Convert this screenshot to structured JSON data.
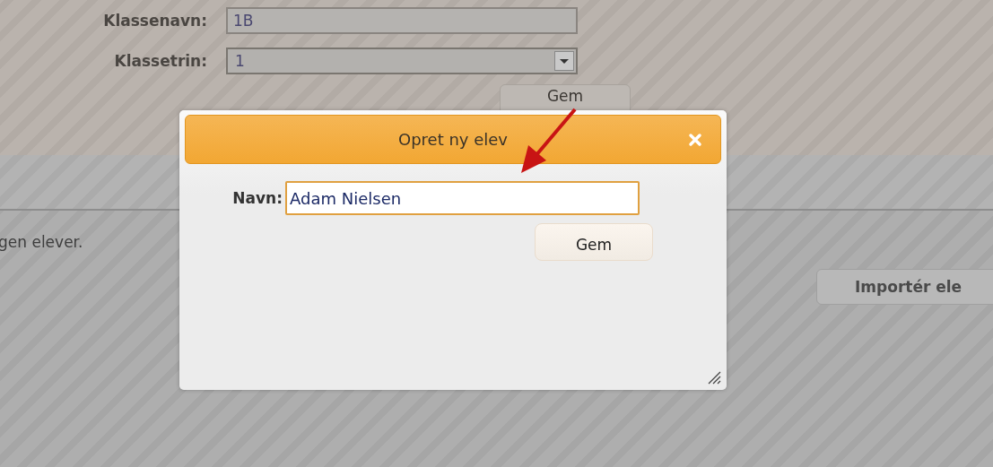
{
  "page": {
    "fields": [
      {
        "label": "Klassenavn:",
        "value": "1B",
        "kind": "text"
      },
      {
        "label": "Klassetrin:",
        "value": "1",
        "kind": "select"
      }
    ],
    "save_button": "Gem",
    "message": "gen elever.",
    "import_button": "Importér ele"
  },
  "dialog": {
    "title": "Opret ny elev",
    "field": {
      "label": "Navn:",
      "value": "Adam Nielsen"
    },
    "save_button": "Gem"
  }
}
